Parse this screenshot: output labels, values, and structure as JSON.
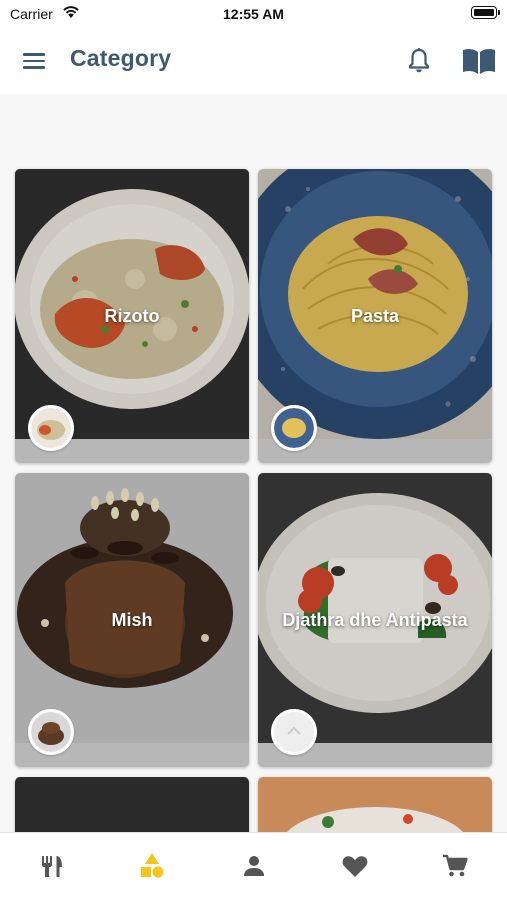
{
  "status_bar": {
    "carrier": "Carrier",
    "time": "12:55 AM"
  },
  "header": {
    "title": "Category",
    "menu_icon": "hamburger-menu-icon",
    "notification_icon": "bell-icon",
    "book_icon": "open-book-icon"
  },
  "categories": [
    {
      "name": "Rizoto"
    },
    {
      "name": "Pasta"
    },
    {
      "name": "Mish"
    },
    {
      "name": "Djathra dhe Antipasta"
    }
  ],
  "tab_bar": {
    "active_color": "#f5c518",
    "inactive_color": "#555555",
    "items": [
      {
        "icon": "fork-knife-icon",
        "active": false
      },
      {
        "icon": "shapes-icon",
        "active": true
      },
      {
        "icon": "person-icon",
        "active": false
      },
      {
        "icon": "heart-icon",
        "active": false
      },
      {
        "icon": "cart-icon",
        "active": false
      }
    ]
  },
  "colors": {
    "primary": "#3d5a73"
  }
}
